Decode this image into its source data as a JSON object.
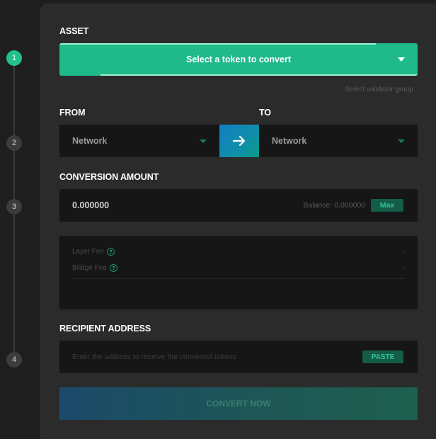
{
  "steps": [
    "1",
    "2",
    "3",
    "4"
  ],
  "asset": {
    "label": "ASSET",
    "select_text": "Select a token to convert",
    "validator_link": "Select validator group"
  },
  "network": {
    "from_label": "FROM",
    "to_label": "TO",
    "from_value": "Network",
    "to_value": "Network"
  },
  "amount": {
    "label": "CONVERSION AMOUNT",
    "value": "0.000000",
    "balance": "Balance: 0.000000",
    "max_label": "Max"
  },
  "fees": [
    {
      "name": "Layer Fee",
      "value": "-"
    },
    {
      "name": "Bridge Fee",
      "value": "-"
    }
  ],
  "recipient": {
    "label": "RECIPIENT ADDRESS",
    "placeholder": "Enter the address to receive the converted tokens",
    "paste_label": "PASTE"
  },
  "convert_label": "CONVERT NOW",
  "colors": {
    "accent": "#1fb98a",
    "panel": "#2b2b2b",
    "field": "#161616",
    "swap_blue": "#127ec4"
  }
}
